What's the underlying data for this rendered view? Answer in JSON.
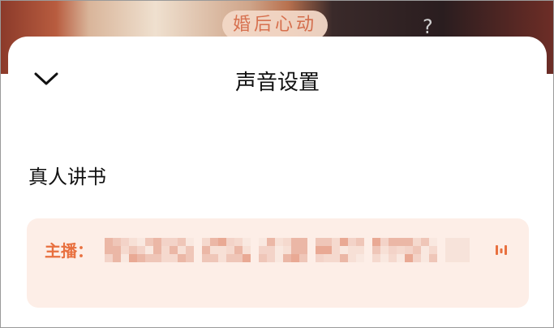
{
  "backdrop": {
    "cover_title": "婚后心动",
    "cover_glyph": "?"
  },
  "sheet": {
    "title": "声音设置",
    "collapse_icon": "chevron-down-icon"
  },
  "section": {
    "title": "真人讲书"
  },
  "host": {
    "label": "主播：",
    "name_redacted": true,
    "audio_icon": "sound-wave-icon"
  },
  "colors": {
    "accent": "#e8703f",
    "card_bg": "#fdeee7",
    "text": "#111111"
  }
}
